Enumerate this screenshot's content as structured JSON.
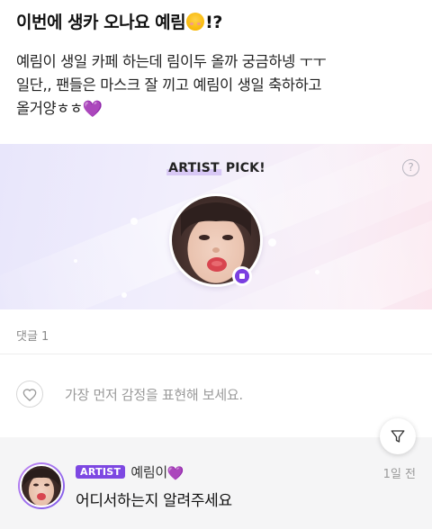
{
  "post": {
    "title": "이번에 생카 오나요 예림",
    "title_emoji": "smiling-face-emoji",
    "title_suffix": "!?",
    "body_lines": [
      "예림이 생일 카페 하는데 림이두 올까 궁금하넹 ㅜㅜ",
      "일단,, 팬들은 마스크 잘 끼고 예림이 생일 축하하고",
      "올거양ㅎㅎ"
    ],
    "body_heart": "💜"
  },
  "artist_pick": {
    "label_highlight": "ARTIST",
    "label_rest": " PICK!",
    "help_symbol": "?",
    "colors": {
      "badge": "#7a3fe0"
    }
  },
  "comments": {
    "count_label": "댓글 1",
    "reaction_placeholder": "가장 먼저 감정을 표현해 보세요.",
    "items": [
      {
        "badge": "ARTIST",
        "name": "예림이",
        "name_heart": "💜",
        "time": "1일 전",
        "text": "어디서하는지 알려주세요"
      }
    ]
  },
  "icons": [
    "help-icon",
    "heart-outline-icon",
    "filter-icon",
    "artist-verified-icon"
  ],
  "colors": {
    "accent": "#7d48e2",
    "heart": "#a23ce6"
  }
}
